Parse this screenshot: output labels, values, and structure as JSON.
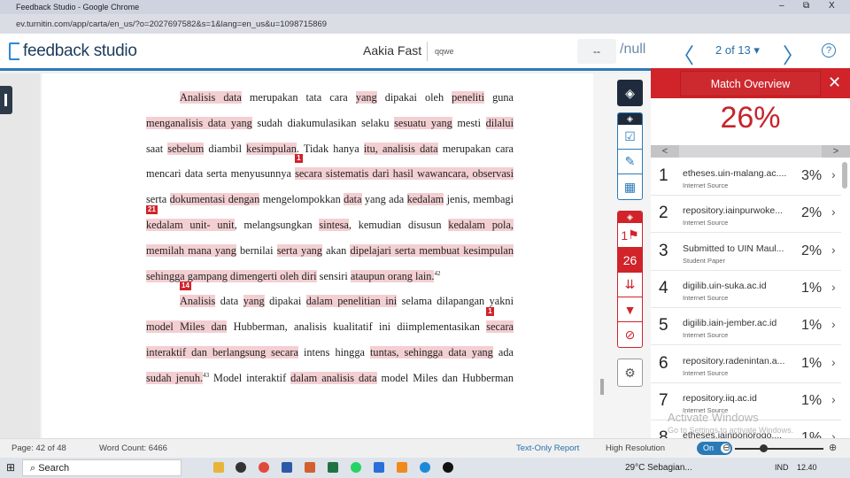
{
  "browser": {
    "title": "Feedback Studio - Google Chrome",
    "url": "ev.turnitin.com/app/carta/en_us/?o=2027697582&s=1&lang=en_us&u=1098715869",
    "controls": [
      "–",
      "⧉",
      "X"
    ]
  },
  "header": {
    "logo": "feedback studio",
    "author": "Aakia Fast",
    "subtitle": "qqwe",
    "page_input": "--",
    "page_total": "/null",
    "prev": "〈",
    "next": "〉",
    "paper_position": "2 of 13 ▾",
    "help": "?"
  },
  "document": {
    "lines": [
      {
        "cls": "indent",
        "segs": [
          {
            "t": "Analisis data",
            "h": true
          },
          {
            "t": " merupakan tata cara  "
          },
          {
            "t": "yang",
            "h": true
          },
          {
            "t": " dipakai oleh "
          },
          {
            "t": "peneliti",
            "h": true
          },
          {
            "t": " guna"
          }
        ]
      },
      {
        "segs": [
          {
            "t": "menganalisis data yang",
            "h": true
          },
          {
            "t": " sudah diakumulasikan selaku "
          },
          {
            "t": "sesuatu yang",
            "h": true
          },
          {
            "t": " mesti "
          },
          {
            "t": "dilalui",
            "h": true
          }
        ]
      },
      {
        "segs": [
          {
            "t": "saat "
          },
          {
            "t": "sebelum",
            "h": true
          },
          {
            "t": " diambil "
          },
          {
            "t": "kesimpulan",
            "h": true
          },
          {
            "t": ". Tidak hanya "
          },
          {
            "t": "itu, analisis data",
            "h": true
          },
          {
            "t": " merupakan cara"
          }
        ]
      },
      {
        "segs": [
          {
            "t": "mencari data serta menyusunnya "
          },
          {
            "t": "secara sistematis dari hasil wawancara, observasi",
            "h": true,
            "m": "1"
          }
        ]
      },
      {
        "segs": [
          {
            "t": "serta "
          },
          {
            "t": "dokumentasi dengan",
            "h": true
          },
          {
            "t": " mengelompokkan "
          },
          {
            "t": "data",
            "h": true
          },
          {
            "t": " yang ada "
          },
          {
            "t": "kedalam",
            "h": true
          },
          {
            "t": " jenis, membagi"
          }
        ]
      },
      {
        "segs": [
          {
            "t": "kedalam unit- unit",
            "h": true,
            "m": "21"
          },
          {
            "t": ", melangsungkan "
          },
          {
            "t": "sintesa",
            "h": true
          },
          {
            "t": ", kemudian disusun "
          },
          {
            "t": "kedalam pola,",
            "h": true
          }
        ]
      },
      {
        "segs": [
          {
            "t": "memilah mana yang",
            "h": true
          },
          {
            "t": " bernilai "
          },
          {
            "t": "serta yang",
            "h": true
          },
          {
            "t": " akan "
          },
          {
            "t": "dipelajari serta membuat kesimpulan",
            "h": true
          }
        ]
      },
      {
        "cls": "last",
        "segs": [
          {
            "t": "sehingga gampang dimengerti oleh diri",
            "h": true
          },
          {
            "t": " sensiri "
          },
          {
            "t": "ataupun orang lain.",
            "h": true
          },
          {
            "t": "42",
            "sup": true
          }
        ]
      },
      {
        "cls": "indent",
        "segs": [
          {
            "t": "Analisis",
            "h": true,
            "m": "14"
          },
          {
            "t": " data "
          },
          {
            "t": "yang",
            "h": true
          },
          {
            "t": " dipakai "
          },
          {
            "t": "dalam penelitian ini",
            "h": true
          },
          {
            "t": " selama dilapangan yakni"
          }
        ]
      },
      {
        "segs": [
          {
            "t": "model Miles dan",
            "h": true
          },
          {
            "t": " Hubberman, analisis kualitatif ini diimplementasikan "
          },
          {
            "t": "secara",
            "h": true,
            "m": "1"
          }
        ]
      },
      {
        "segs": [
          {
            "t": "interaktif dan berlangsung secara",
            "h": true
          },
          {
            "t": " intens hingga "
          },
          {
            "t": "tuntas, sehingga data yang",
            "h": true
          },
          {
            "t": " ada"
          }
        ]
      },
      {
        "segs": [
          {
            "t": "sudah jenuh.",
            "h": true
          },
          {
            "t": "43",
            "sup": true
          },
          {
            "t": " Model interaktif "
          },
          {
            "t": "dalam analisis data",
            "h": true
          },
          {
            "t": " model Miles dan Hubberman"
          }
        ]
      }
    ]
  },
  "toolbar": {
    "flag_count": "1",
    "match_count": "26"
  },
  "panel": {
    "title": "Match Overview",
    "close": "✕",
    "similarity": "26%",
    "scroll_left": "<",
    "scroll_right": ">",
    "matches": [
      {
        "n": "1",
        "source": "etheses.uin-malang.ac....",
        "type": "Internet Source",
        "pct": "3%"
      },
      {
        "n": "2",
        "source": "repository.iainpurwoke...",
        "type": "Internet Source",
        "pct": "2%"
      },
      {
        "n": "3",
        "source": "Submitted to UIN Maul...",
        "type": "Student Paper",
        "pct": "2%"
      },
      {
        "n": "4",
        "source": "digilib.uin-suka.ac.id",
        "type": "Internet Source",
        "pct": "1%"
      },
      {
        "n": "5",
        "source": "digilib.iain-jember.ac.id",
        "type": "Internet Source",
        "pct": "1%"
      },
      {
        "n": "6",
        "source": "repository.radenintan.a...",
        "type": "Internet Source",
        "pct": "1%"
      },
      {
        "n": "7",
        "source": "repository.iiq.ac.id",
        "type": "Internet Source",
        "pct": "1%"
      },
      {
        "n": "8",
        "source": "etheses.iainponorogo....",
        "type": "",
        "pct": "1%"
      }
    ]
  },
  "watermark": {
    "line1": "Activate Windows",
    "line2": "Go to Settings to activate Windows."
  },
  "footer": {
    "page": "Page: 42 of 48",
    "words": "Word Count: 6466",
    "text_only": "Text-Only Report",
    "high_res": "High Resolution",
    "toggle": "On"
  },
  "taskbar": {
    "search": "Search",
    "weather": "29°C  Sebagian...",
    "lang": "IND",
    "time": "12.40"
  },
  "colors": {
    "accent": "#2a7ab8",
    "match_red": "#d0232a",
    "highlight": "#f3cfd2"
  }
}
